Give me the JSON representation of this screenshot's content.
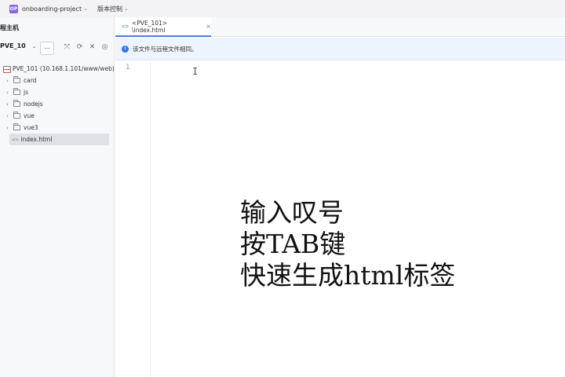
{
  "titlebar": {
    "logo_text": "OP",
    "project_name": "onboarding-project",
    "vcs_label": "版本控制"
  },
  "left_panel": {
    "title": "程主机",
    "host_select": "PVE_10",
    "more_label": "...",
    "toolbar_icons": [
      "collapse-icon",
      "refresh-icon",
      "close-icon",
      "target-icon"
    ],
    "tree": {
      "root": "PVE_101 (10.168.1.101/www/web)",
      "folders": [
        "card",
        "js",
        "nodejs",
        "vue",
        "vue3"
      ],
      "file": "index.html",
      "file_icon": "<>"
    }
  },
  "editor_tab": {
    "icon": "<>",
    "label": "<PVE_101> \\index.html",
    "close": "×"
  },
  "notice": {
    "icon": "i",
    "text": "该文件与远程文件相同。"
  },
  "editor": {
    "line_number": "1",
    "cursor": "I"
  },
  "caption": {
    "line1": "输入叹号",
    "line2": "按TAB键",
    "line3": "快速生成html标签"
  },
  "colors": {
    "accent": "#4b7bec",
    "logo": "#8a63e8",
    "notice_bg": "#eef4fd",
    "selected_row": "#dfe1e5"
  }
}
